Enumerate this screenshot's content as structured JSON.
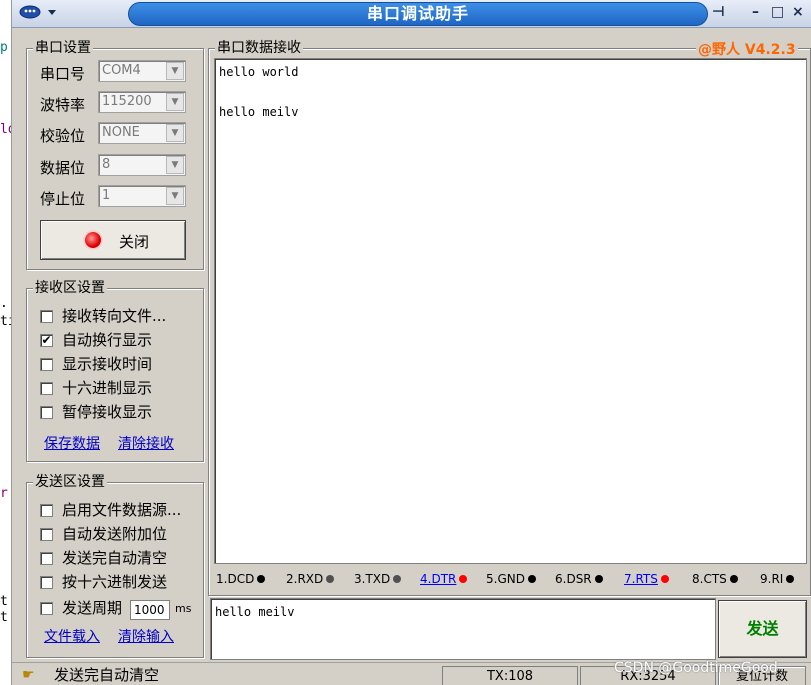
{
  "bg_fragments": [
    "p",
    "ld",
    ".",
    "ti",
    "r",
    "t",
    "t"
  ],
  "window": {
    "title": "串口调试助手",
    "version": "@野人 V4.2.3",
    "controls": {
      "pin": "⊣",
      "minimize": "–",
      "maximize": "□",
      "close": "×"
    }
  },
  "port_settings": {
    "legend": "串口设置",
    "fields": [
      {
        "label": "串口号",
        "value": "COM4"
      },
      {
        "label": "波特率",
        "value": "115200"
      },
      {
        "label": "校验位",
        "value": "NONE"
      },
      {
        "label": "数据位",
        "value": "8"
      },
      {
        "label": "停止位",
        "value": "1"
      }
    ],
    "open_button": "关闭"
  },
  "receive_settings": {
    "legend": "接收区设置",
    "options": [
      {
        "label": "接收转向文件...",
        "checked": false
      },
      {
        "label": "自动换行显示",
        "checked": true
      },
      {
        "label": "显示接收时间",
        "checked": false
      },
      {
        "label": "十六进制显示",
        "checked": false
      },
      {
        "label": "暂停接收显示",
        "checked": false
      }
    ],
    "save_link": "保存数据",
    "clear_link": "清除接收"
  },
  "send_settings": {
    "legend": "发送区设置",
    "options": [
      {
        "label": "启用文件数据源...",
        "checked": false
      },
      {
        "label": "自动发送附加位",
        "checked": false
      },
      {
        "label": "发送完自动清空",
        "checked": false
      },
      {
        "label": "按十六进制发送",
        "checked": false
      },
      {
        "label": "发送周期",
        "checked": false
      }
    ],
    "period_value": "1000",
    "period_unit": "ms",
    "load_link": "文件载入",
    "clear_link": "清除输入"
  },
  "receive_area": {
    "legend": "串口数据接收",
    "lines": [
      "hello world",
      "hello meilv"
    ]
  },
  "signals": [
    {
      "label": "1.DCD",
      "dot": "#000000",
      "link": false
    },
    {
      "label": "2.RXD",
      "dot": "#505050",
      "link": false
    },
    {
      "label": "3.TXD",
      "dot": "#505050",
      "link": false
    },
    {
      "label": "4.DTR",
      "dot": "#ff0000",
      "link": true
    },
    {
      "label": "5.GND",
      "dot": "#000000",
      "link": false
    },
    {
      "label": "6.DSR",
      "dot": "#000000",
      "link": false
    },
    {
      "label": "7.RTS",
      "dot": "#ff0000",
      "link": true
    },
    {
      "label": "8.CTS",
      "dot": "#000000",
      "link": false
    },
    {
      "label": "9.RI",
      "dot": "#000000",
      "link": false
    }
  ],
  "send_area": {
    "text": "hello meilv",
    "send_button": "发送"
  },
  "status_bar": {
    "clear_label": "发送完自动清空",
    "tx": "TX:108",
    "rx": "RX:3254",
    "reset": "复位计数",
    "watermark": "CSDN @GoodtimeGood"
  }
}
